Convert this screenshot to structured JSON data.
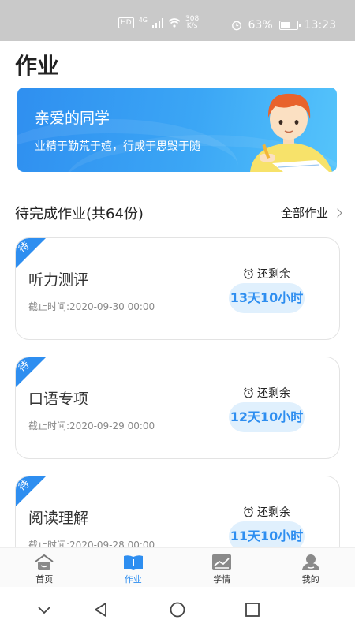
{
  "status_bar": {
    "network_hd": "HD",
    "network_type": "4G",
    "speed_value": "308",
    "speed_unit": "K/s",
    "battery": "63%",
    "battery_level": 0.63,
    "time": "13:23"
  },
  "page": {
    "title": "作业"
  },
  "banner": {
    "title": "亲爱的同学",
    "subtitle": "业精于勤荒于嬉，行成于思毁于随"
  },
  "section": {
    "title": "待完成作业(共64份)",
    "all_link": "全部作业"
  },
  "homework": [
    {
      "tag": "待",
      "title": "听力测评",
      "deadline": "截止时间:2020-09-30 00:00",
      "remain_label": "还剩余",
      "remain": "13天10小时"
    },
    {
      "tag": "待",
      "title": "口语专项",
      "deadline": "截止时间:2020-09-29 00:00",
      "remain_label": "还剩余",
      "remain": "12天10小时"
    },
    {
      "tag": "待",
      "title": "阅读理解",
      "deadline": "截止时间:2020-09-28 00:00",
      "remain_label": "还剩余",
      "remain": "11天10小时"
    }
  ],
  "tabs": [
    {
      "label": "首页",
      "icon": "home-icon"
    },
    {
      "label": "作业",
      "icon": "book-icon",
      "active": true
    },
    {
      "label": "学情",
      "icon": "chart-icon"
    },
    {
      "label": "我的",
      "icon": "profile-icon"
    }
  ],
  "colors": {
    "accent": "#2e8ef0",
    "pill_bg": "#e0f0fd",
    "status_bar": "#c9c9c9"
  }
}
